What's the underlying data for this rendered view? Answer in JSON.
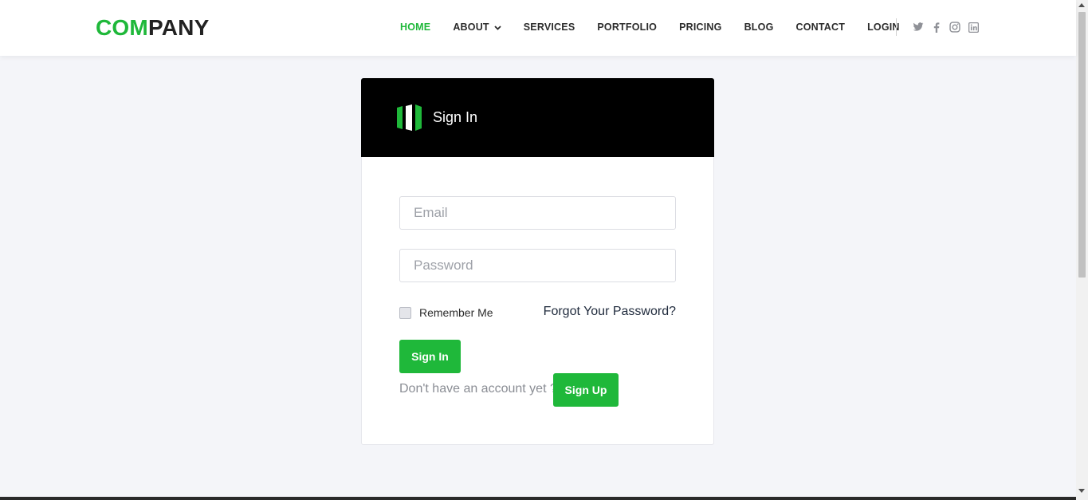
{
  "logo": {
    "accent": "COM",
    "rest": "PANY"
  },
  "nav": {
    "items": [
      {
        "label": "HOME",
        "active": true
      },
      {
        "label": "ABOUT",
        "dropdown": true
      },
      {
        "label": "SERVICES"
      },
      {
        "label": "PORTFOLIO"
      },
      {
        "label": "PRICING"
      },
      {
        "label": "BLOG"
      },
      {
        "label": "CONTACT"
      },
      {
        "label": "LOGIN"
      }
    ],
    "socials": [
      "twitter-icon",
      "facebook-icon",
      "instagram-icon",
      "linkedin-icon"
    ]
  },
  "card": {
    "title": "Sign In",
    "email_placeholder": "Email",
    "password_placeholder": "Password",
    "remember_label": "Remember Me",
    "forgot_label": "Forgot Your Password?",
    "signin_label": "Sign In",
    "no_account_text": "Don't have an account yet ?",
    "signup_label": "Sign Up"
  },
  "colors": {
    "accent": "#1fb83a",
    "header_bg": "#000000",
    "page_bg": "#f4f5f9"
  }
}
